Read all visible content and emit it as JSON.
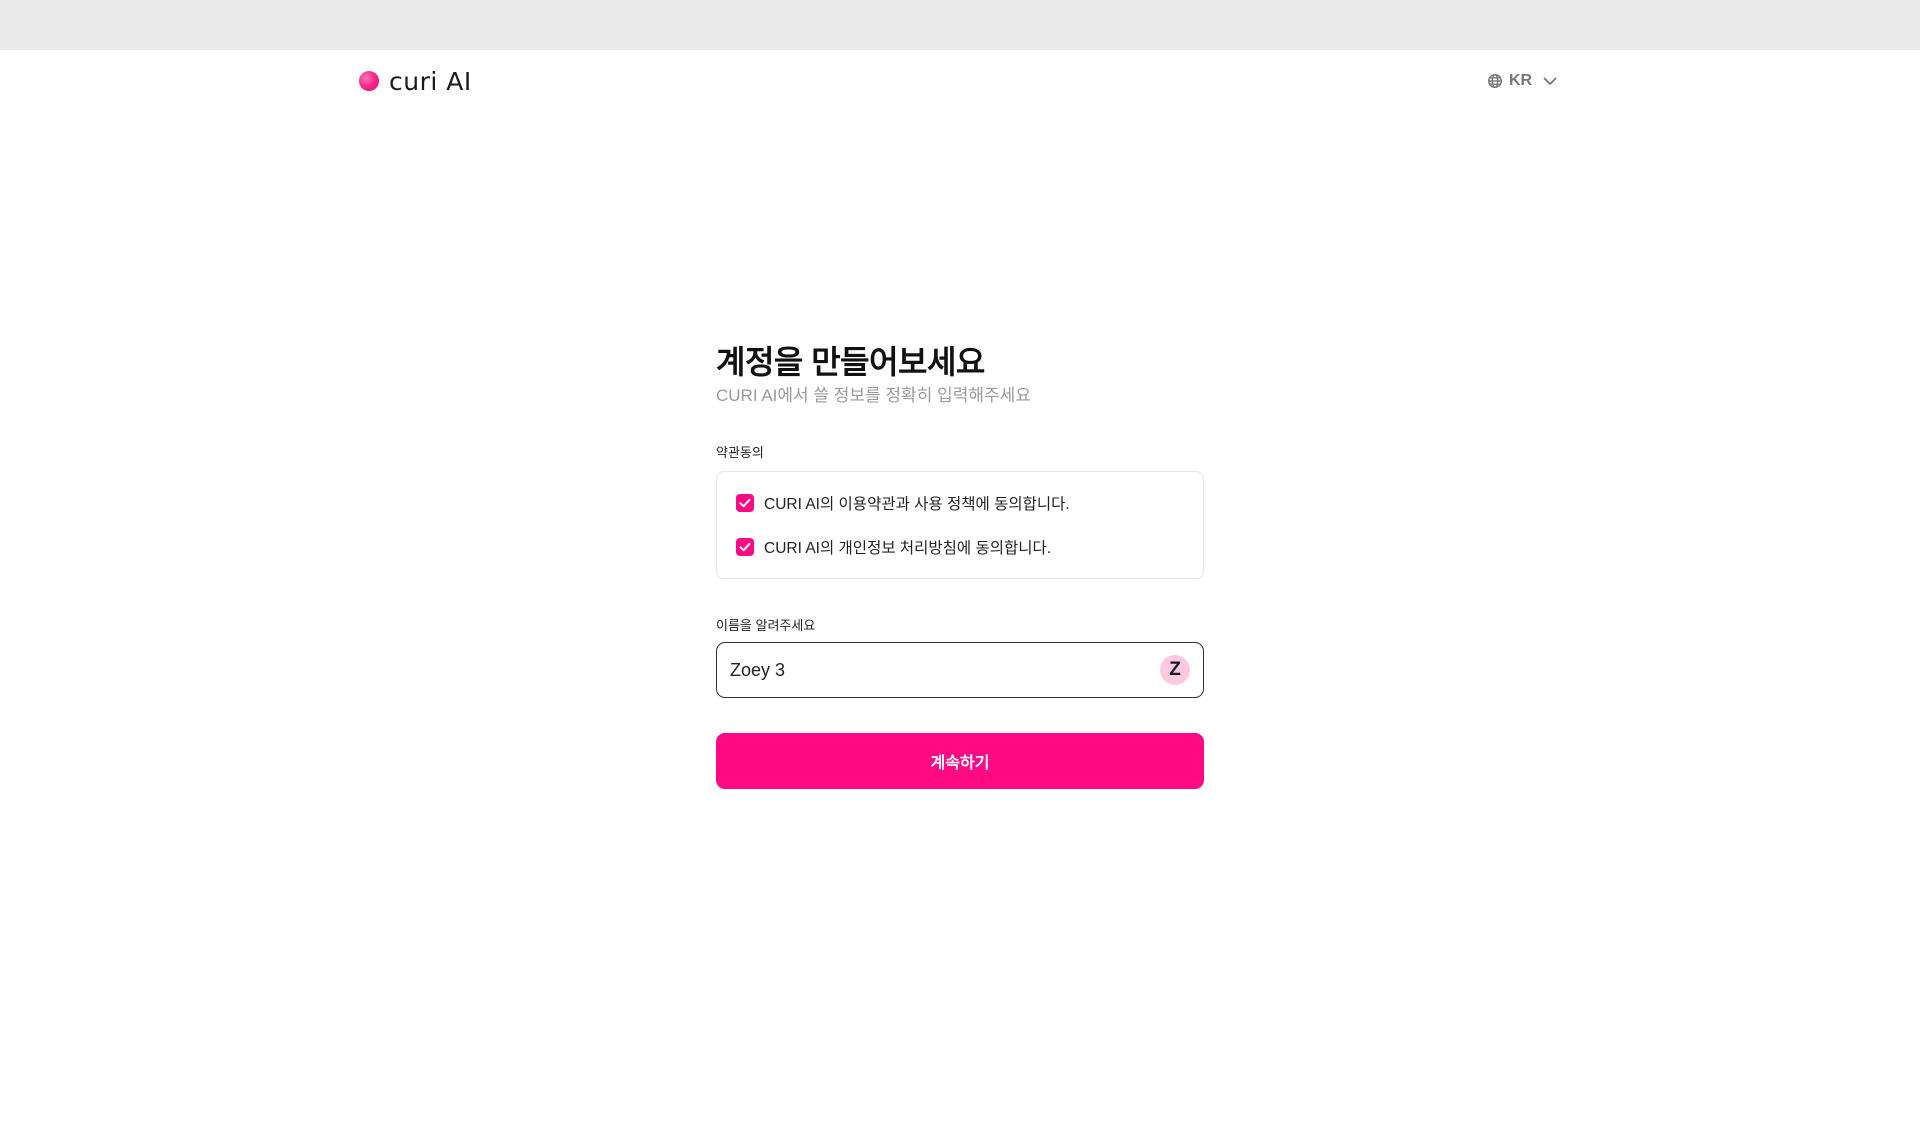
{
  "brand": {
    "logo_text": "curi AI",
    "accent_color": "#ff0a84"
  },
  "header": {
    "language": {
      "label": "KR",
      "icon": "globe-icon",
      "chevron_icon": "chevron-down-icon"
    }
  },
  "form": {
    "title": "계정을 만들어보세요",
    "subtitle": "CURI AI에서 쓸 정보를 정확히 입력해주세요",
    "terms": {
      "label": "약관동의",
      "items": [
        {
          "text": "CURI AI의 이용약관과 사용 정책에 동의합니다.",
          "checked": true
        },
        {
          "text": "CURI AI의 개인정보 처리방침에 동의합니다.",
          "checked": true
        }
      ]
    },
    "name": {
      "label": "이름을 알려주세요",
      "value": "Zoey 3",
      "avatar_initial": "Z"
    },
    "continue_label": "계속하기"
  }
}
